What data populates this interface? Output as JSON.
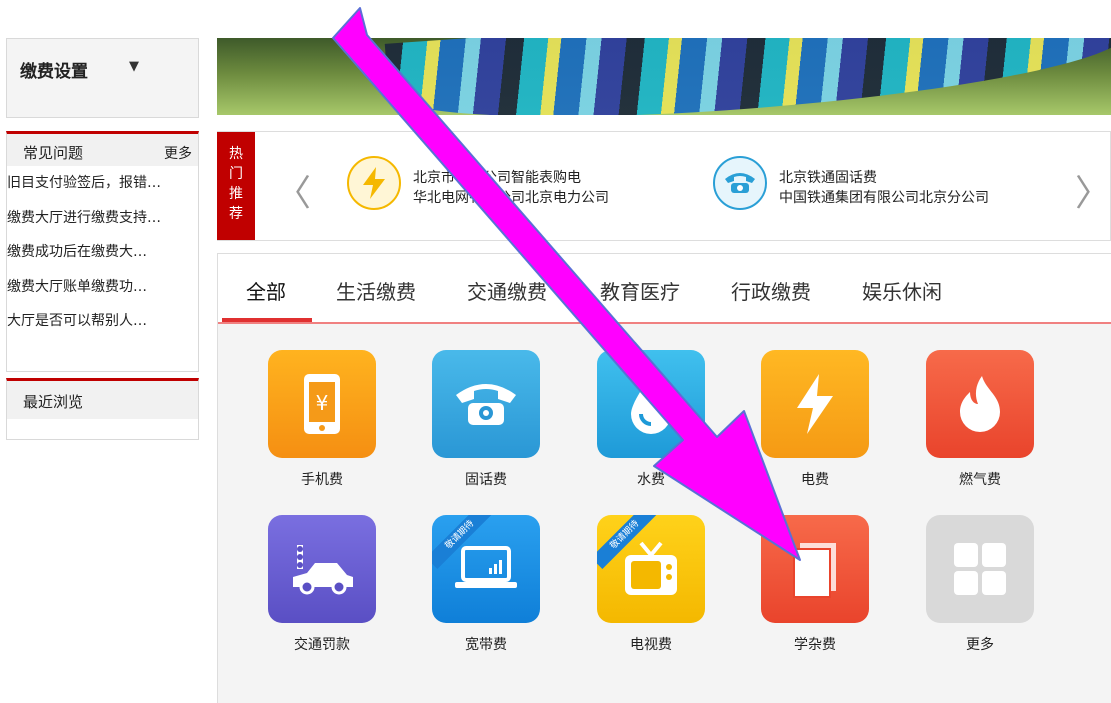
{
  "sidebar": {
    "pay_settings": {
      "label": "缴费设置",
      "arrow": "▼"
    },
    "faq": {
      "title": "常见问题",
      "more": "更多",
      "items": [
        "旧目支付验签后，报错…",
        "缴费大厅进行缴费支持…",
        "缴费成功后在缴费大…",
        "缴费大厅账单缴费功…",
        "大厅是否可以帮别人…"
      ]
    },
    "recent": {
      "title": "最近浏览"
    }
  },
  "hot": {
    "tag": [
      "热",
      "门",
      "推",
      "荐"
    ],
    "prev": "〈",
    "next": "〉",
    "items": [
      {
        "line1": "北京市电力公司智能表购电",
        "line2": "华北电网有限公司北京电力公司",
        "icon": "lightning-icon",
        "color": "#f5b800"
      },
      {
        "line1": "北京铁通固话费",
        "line2": "中国铁通集团有限公司北京分公司",
        "icon": "telephone-icon",
        "color": "#2a9fd6"
      }
    ]
  },
  "tabs": [
    "全部",
    "生活缴费",
    "交通缴费",
    "教育医疗",
    "行政缴费",
    "娱乐休闲"
  ],
  "services": [
    {
      "label": "手机费",
      "icon": "mobile-icon",
      "color": "#f7a21b"
    },
    {
      "label": "固话费",
      "icon": "telephone-icon",
      "color": "#35a8de"
    },
    {
      "label": "水费",
      "icon": "water-drop-icon",
      "color": "#2fb2e6"
    },
    {
      "label": "电费",
      "icon": "lightning-icon",
      "color": "#f8a81c"
    },
    {
      "label": "燃气费",
      "icon": "flame-icon",
      "color": "#f2573c"
    },
    {
      "label": "交通罚款",
      "icon": "car-icon",
      "color": "#6a5fd3"
    },
    {
      "label": "宽带费",
      "icon": "laptop-icon",
      "color": "#1a8fe0",
      "ribbon": "敬请期待"
    },
    {
      "label": "电视费",
      "icon": "tv-icon",
      "color": "#f4c400",
      "ribbon": "敬请期待"
    },
    {
      "label": "学杂费",
      "icon": "book-icon",
      "color": "#f2573c"
    },
    {
      "label": "更多",
      "icon": "grid-icon",
      "color": "#d6d6d6"
    }
  ]
}
